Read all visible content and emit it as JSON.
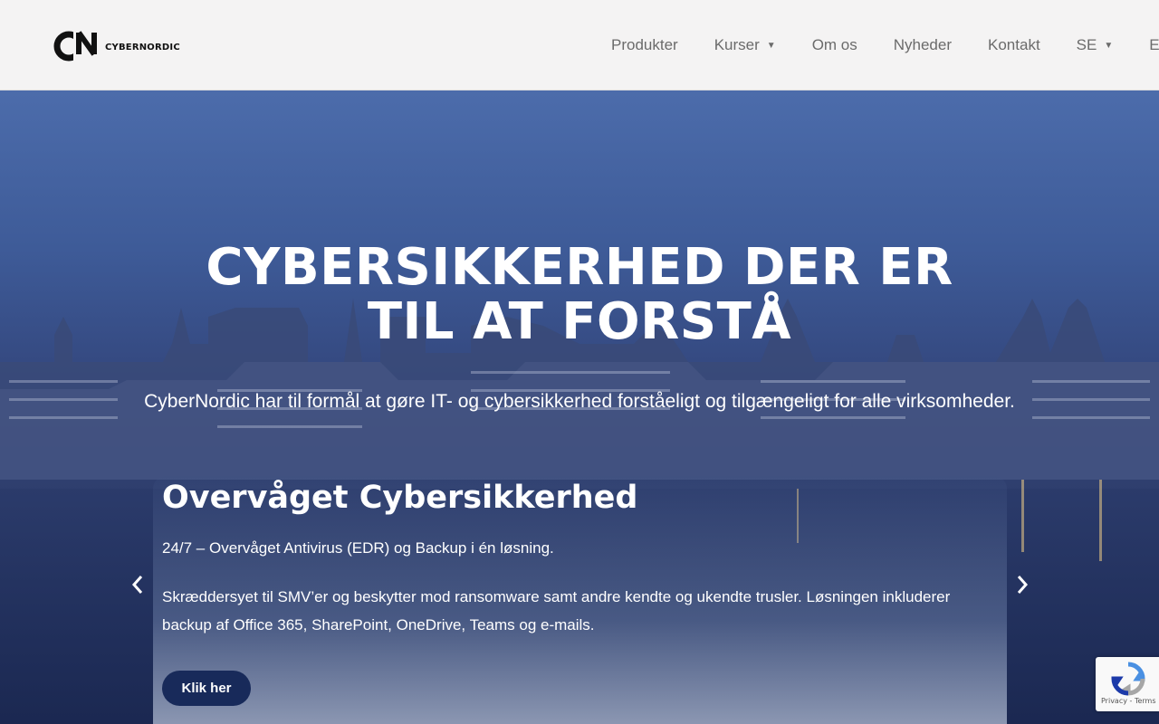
{
  "header": {
    "logo_text": "CYBERNORDIC",
    "nav": [
      {
        "label": "Produkter",
        "has_dropdown": false
      },
      {
        "label": "Kurser",
        "has_dropdown": true
      },
      {
        "label": "Om os",
        "has_dropdown": false
      },
      {
        "label": "Nyheder",
        "has_dropdown": false
      },
      {
        "label": "Kontakt",
        "has_dropdown": false
      },
      {
        "label": "SE",
        "has_dropdown": true
      },
      {
        "label": "EU",
        "has_dropdown": false
      }
    ],
    "dropdown_icon": "▼"
  },
  "hero": {
    "title_line1": "CYBERSIKKERHED DER ER",
    "title_line2": "TIL AT FORSTÅ",
    "subtitle": "CyberNordic har til formål at gøre IT- og cybersikkerhed forståeligt og tilgængeligt for alle virksomheder."
  },
  "slide": {
    "title": "Overvåget Cybersikkerhed",
    "paragraph1": "24/7 – Overvåget Antivirus (EDR) og Backup i én løsning.",
    "paragraph2": "Skræddersyet til SMV’er og beskytter mod ransomware samt andre kendte og ukendte trusler. Løsningen inkluderer backup af Office 365, SharePoint, OneDrive, Teams og e-mails.",
    "button_label": "Klik her"
  },
  "recaptcha": {
    "links": "Privacy - Terms"
  },
  "colors": {
    "header_bg": "#f4f3f3",
    "nav_text": "#6b6b6b",
    "button_bg": "#182a5a",
    "hero_text": "#ffffff"
  },
  "icons": {
    "prev": "chevron-left-icon",
    "next": "chevron-right-icon",
    "recaptcha": "recaptcha-icon"
  }
}
